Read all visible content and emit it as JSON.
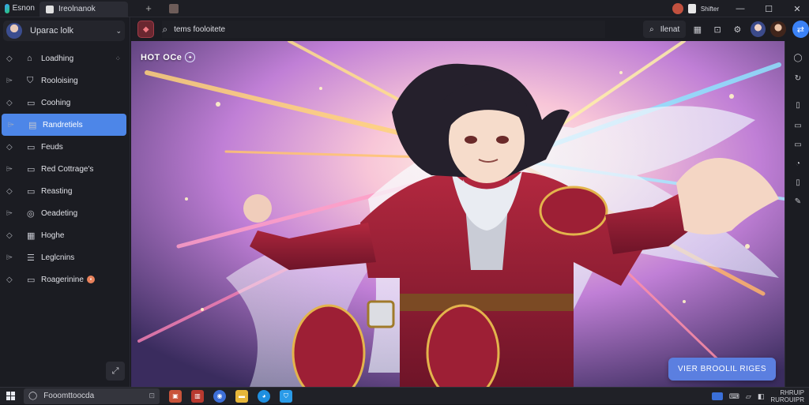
{
  "titlebar": {
    "app_name": "Esnon",
    "tab_label": "Ireolnanok",
    "new_tab": "+",
    "right_label": "Shifter",
    "minimize": "—",
    "maximize": "☐",
    "close": "✕"
  },
  "sidebar": {
    "profile_name": "Uparac lolk",
    "items": [
      {
        "label": "Loadhing",
        "icon": "home-icon",
        "glyph": "⌂"
      },
      {
        "label": "Rooloising",
        "icon": "shield-icon",
        "glyph": "⛉"
      },
      {
        "label": "Coohing",
        "icon": "folder-icon",
        "glyph": "▭"
      },
      {
        "label": "Randretiels",
        "icon": "document-icon",
        "glyph": "▤",
        "active": true
      },
      {
        "label": "Feuds",
        "icon": "page-icon",
        "glyph": "▭"
      },
      {
        "label": "Red Cottrage's",
        "icon": "tag-icon",
        "glyph": "▭"
      },
      {
        "label": "Reasting",
        "icon": "image-icon",
        "glyph": "▭"
      },
      {
        "label": "Oeadeting",
        "icon": "settings-icon",
        "glyph": "◎"
      },
      {
        "label": "Hoghe",
        "icon": "grid-icon",
        "glyph": "▦"
      },
      {
        "label": "Leglcnins",
        "icon": "list-icon",
        "glyph": "☰"
      },
      {
        "label": "Roagerinine",
        "icon": "card-icon",
        "glyph": "▭",
        "badge": "•"
      }
    ]
  },
  "toolbar": {
    "search_text": "tems fooloitete",
    "search_button": "Ilenat"
  },
  "stage": {
    "title": "HOT OCe",
    "cta_label": "VIER BROOLIL RIGES"
  },
  "taskbar": {
    "search_text": "Fooomttoocda",
    "time": "RHRUIP",
    "date": "RUROUIPR"
  },
  "colors": {
    "accent": "#4d86e8",
    "cta": "#5b7fe0",
    "background": "#1b1c22"
  }
}
